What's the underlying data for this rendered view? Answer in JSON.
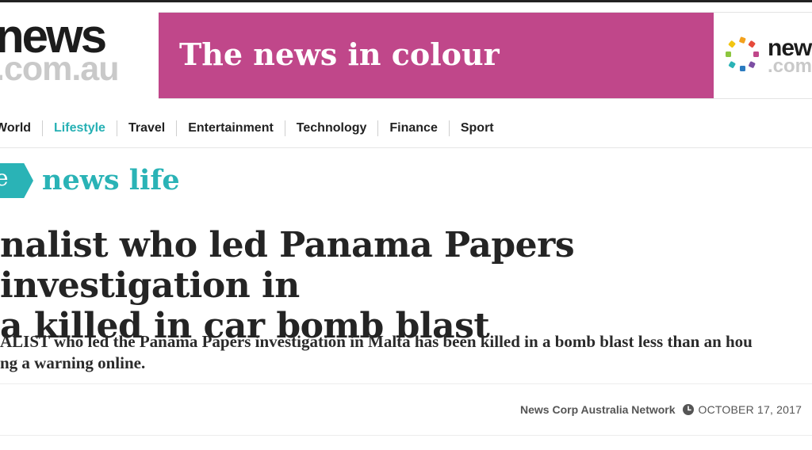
{
  "header": {
    "logo_word": "news",
    "logo_domain": ".com.au"
  },
  "banner": {
    "text": "The news in colour",
    "logo_word": "new",
    "logo_domain": ".com",
    "bg_color": "#c0478a"
  },
  "nav": {
    "items": [
      {
        "label": "World"
      },
      {
        "label": "Lifestyle",
        "active": true
      },
      {
        "label": "Travel"
      },
      {
        "label": "Entertainment"
      },
      {
        "label": "Technology"
      },
      {
        "label": "Finance"
      },
      {
        "label": "Sport"
      }
    ],
    "active_color": "#26b0b4"
  },
  "section": {
    "tag_letter": "e",
    "title": "news life",
    "color": "#2ab3b6"
  },
  "article": {
    "headline_line1": "nalist who led Panama Papers investigation in",
    "headline_line2": "a killed in car bomb blast",
    "standfirst_line1": "ALIST who led the Panama Papers investigation in Malta has been killed in a bomb blast less than an hou",
    "standfirst_line2": "ng a warning online.",
    "author": "News Corp Australia Network",
    "date": "OCTOBER 17, 2017",
    "clock_icon": "clock-icon"
  }
}
